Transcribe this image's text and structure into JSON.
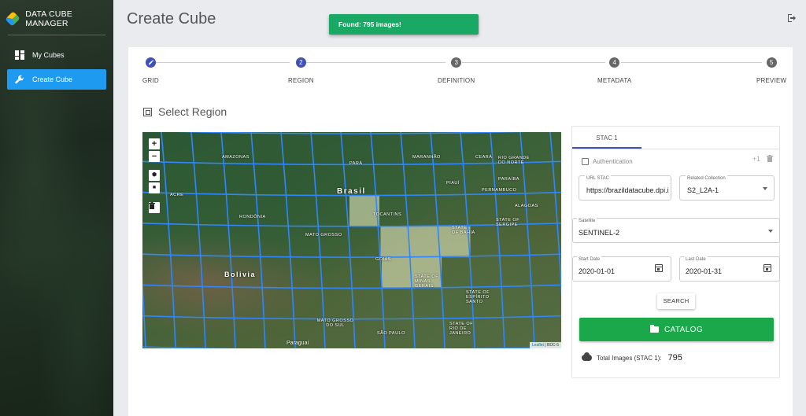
{
  "sidebar": {
    "brand": "DATA CUBE MANAGER",
    "items": [
      {
        "label": "My Cubes",
        "active": false
      },
      {
        "label": "Create Cube",
        "active": true
      }
    ]
  },
  "header": {
    "title": "Create Cube",
    "logout_icon": "logout-icon"
  },
  "toast": {
    "message": "Found: 795 images!",
    "color": "#1aa865"
  },
  "stepper": {
    "steps": [
      {
        "number": "",
        "label": "GRID",
        "state": "done"
      },
      {
        "number": "2",
        "label": "REGION",
        "state": "current"
      },
      {
        "number": "3",
        "label": "DEFINITION",
        "state": "pending"
      },
      {
        "number": "4",
        "label": "METADATA",
        "state": "pending"
      },
      {
        "number": "5",
        "label": "PREVIEW",
        "state": "pending"
      }
    ],
    "accent": "#3f51b5"
  },
  "section": {
    "title": "Select Region"
  },
  "map": {
    "labels": [
      "AMAZONAS",
      "PARÁ",
      "MARANHÃO",
      "CEARÁ",
      "RIO GRANDE DO NORTE",
      "PARAÍBA",
      "PIAUÍ",
      "PERNAMBUCO",
      "ALAGOAS",
      "Brasil",
      "ACRE",
      "RONDÔNIA",
      "TOCANTINS",
      "STATE OF SERGIPE",
      "STATE OF BAHIA",
      "MATO GROSSO",
      "GOIÁS",
      "Bolivia",
      "STATE OF MINAS GERAIS",
      "STATE OF ESPÍRITO SANTO",
      "MATO GROSSO DO SUL",
      "STATE OF RIO DE JANEIRO",
      "SÃO PAULO",
      "Paraguai"
    ],
    "attribution_link": "Leaflet",
    "attribution_rest": " | BDC-5",
    "controls": [
      "+",
      "−"
    ]
  },
  "panel": {
    "tab_label": "STAC 1",
    "auth_label": "Authentication",
    "add_icon": "+1",
    "url_stac": {
      "label": "URL STAC",
      "value": "https://brazildatacube.dpi.inpe.br/stac/"
    },
    "collection": {
      "label": "Related Collection",
      "value": "S2_L2A-1"
    },
    "satellite": {
      "label": "Satellite",
      "value": "SENTINEL-2"
    },
    "start_date": {
      "label": "Start Date",
      "value": "2020-01-01"
    },
    "end_date": {
      "label": "Last Date",
      "value": "2020-01-31"
    },
    "search_label": "SEARCH",
    "catalog_label": "CATALOG",
    "total_label": "Total Images (STAC 1):",
    "total_value": "795",
    "catalog_color": "#1aa84a"
  }
}
